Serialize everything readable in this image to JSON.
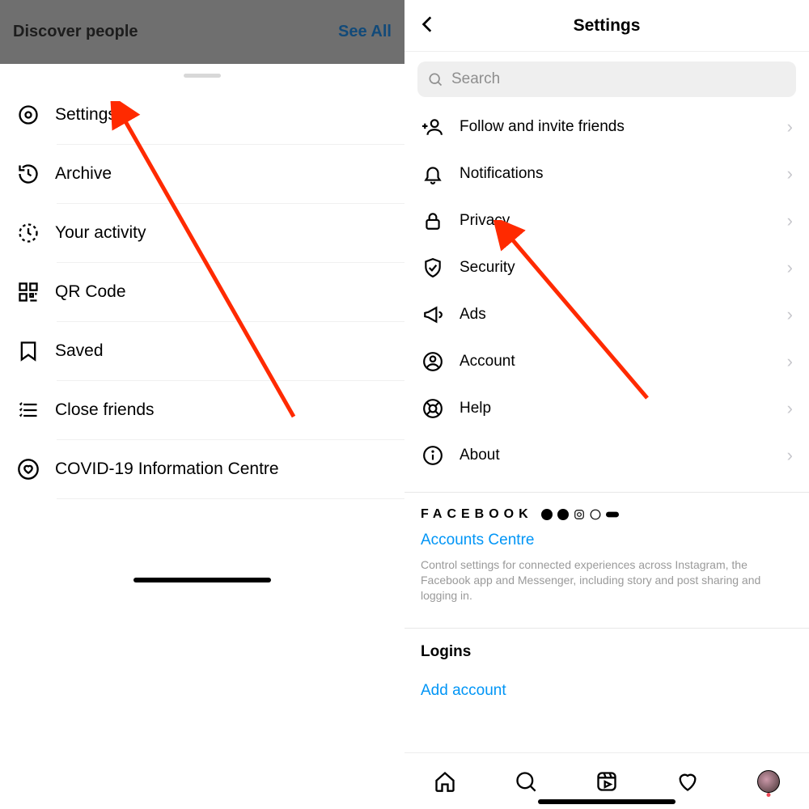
{
  "left": {
    "discover": "Discover people",
    "see_all": "See All",
    "menu": [
      "Settings",
      "Archive",
      "Your activity",
      "QR Code",
      "Saved",
      "Close friends",
      "COVID-19 Information Centre"
    ]
  },
  "right": {
    "title": "Settings",
    "search_placeholder": "Search",
    "items": [
      "Follow and invite friends",
      "Notifications",
      "Privacy",
      "Security",
      "Ads",
      "Account",
      "Help",
      "About"
    ],
    "facebook_label": "FACEBOOK",
    "accounts_centre": "Accounts Centre",
    "accounts_desc": "Control settings for connected experiences across Instagram, the Facebook app and Messenger, including story and post sharing and logging in.",
    "logins_title": "Logins",
    "add_account": "Add account"
  }
}
